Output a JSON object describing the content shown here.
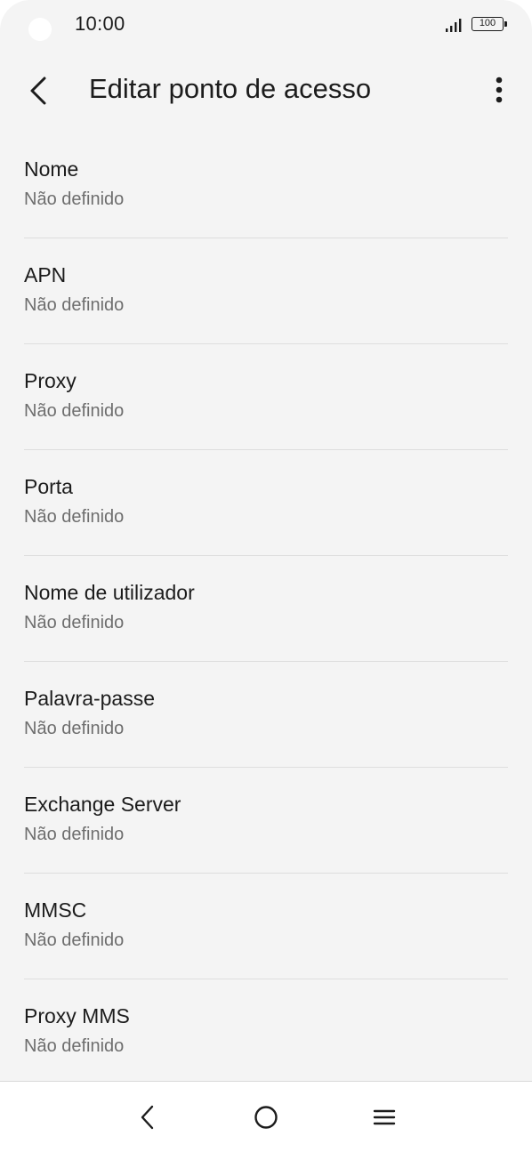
{
  "status_bar": {
    "time": "10:00",
    "battery": "100",
    "icons": [
      "camera-dot",
      "signal-icon",
      "battery-icon"
    ]
  },
  "app_bar": {
    "title": "Editar ponto de acesso",
    "back_icon": "chevron-left-icon",
    "menu_icon": "more-vert-icon"
  },
  "items": [
    {
      "title": "Nome",
      "value": "Não definido"
    },
    {
      "title": "APN",
      "value": "Não definido"
    },
    {
      "title": "Proxy",
      "value": "Não definido"
    },
    {
      "title": "Porta",
      "value": "Não definido"
    },
    {
      "title": "Nome de utilizador",
      "value": "Não definido"
    },
    {
      "title": "Palavra-passe",
      "value": "Não definido"
    },
    {
      "title": "Exchange Server",
      "value": "Não definido"
    },
    {
      "title": "MMSC",
      "value": "Não definido"
    },
    {
      "title": "Proxy MMS",
      "value": "Não definido"
    }
  ],
  "nav_bar": {
    "icons": [
      "nav-back-icon",
      "nav-home-icon",
      "nav-recents-icon"
    ]
  },
  "colors": {
    "background": "#f4f4f4",
    "text_primary": "#1c1c1c",
    "text_secondary": "#6e6e6e",
    "divider": "#dedede",
    "nav_background": "#ffffff"
  }
}
